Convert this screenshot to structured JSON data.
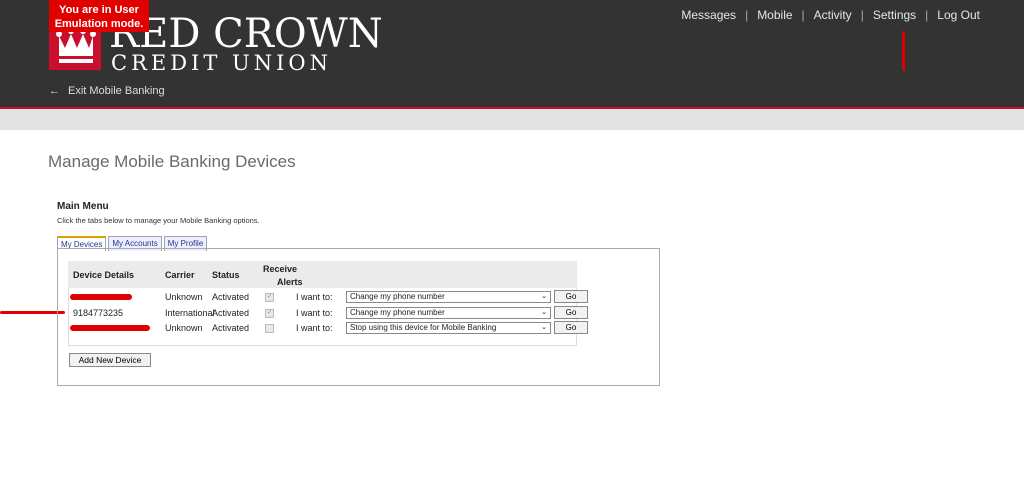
{
  "header": {
    "emulation_notice": "You are in User Emulation mode.",
    "brand_name": "RED CROWN",
    "brand_sub": "CREDIT UNION",
    "exit_label": "Exit Mobile Banking",
    "nav": [
      {
        "label": "Messages"
      },
      {
        "label": "Mobile"
      },
      {
        "label": "Activity"
      },
      {
        "label": "Settings"
      },
      {
        "label": "Log Out"
      }
    ]
  },
  "page": {
    "title": "Manage Mobile Banking Devices",
    "section_title": "Main Menu",
    "instructions": "Click the tabs below to manage your Mobile Banking options."
  },
  "tabs": [
    {
      "label": "My Devices",
      "active": true
    },
    {
      "label": "My Accounts",
      "active": false
    },
    {
      "label": "My Profile",
      "active": false
    }
  ],
  "table": {
    "headers": {
      "device": "Device Details",
      "carrier": "Carrier",
      "status": "Status",
      "alerts_line1": "Receive",
      "alerts_line2": "Alerts"
    },
    "rows": [
      {
        "device": "",
        "carrier": "Unknown",
        "status": "Activated",
        "alerts_checked": true,
        "prompt": "I want to:",
        "action": "Change my phone number",
        "go": "Go"
      },
      {
        "device": "9184773235",
        "carrier": "International",
        "status": "Activated",
        "alerts_checked": true,
        "prompt": "I want to:",
        "action": "Change my phone number",
        "go": "Go"
      },
      {
        "device": "",
        "carrier": "Unknown",
        "status": "Activated",
        "alerts_checked": false,
        "prompt": "I want to:",
        "action": "Stop using this device for Mobile Banking",
        "go": "Go"
      }
    ]
  },
  "add_device_label": "Add New Device",
  "colors": {
    "header_bg": "#333333",
    "brand_red": "#c8102e"
  }
}
